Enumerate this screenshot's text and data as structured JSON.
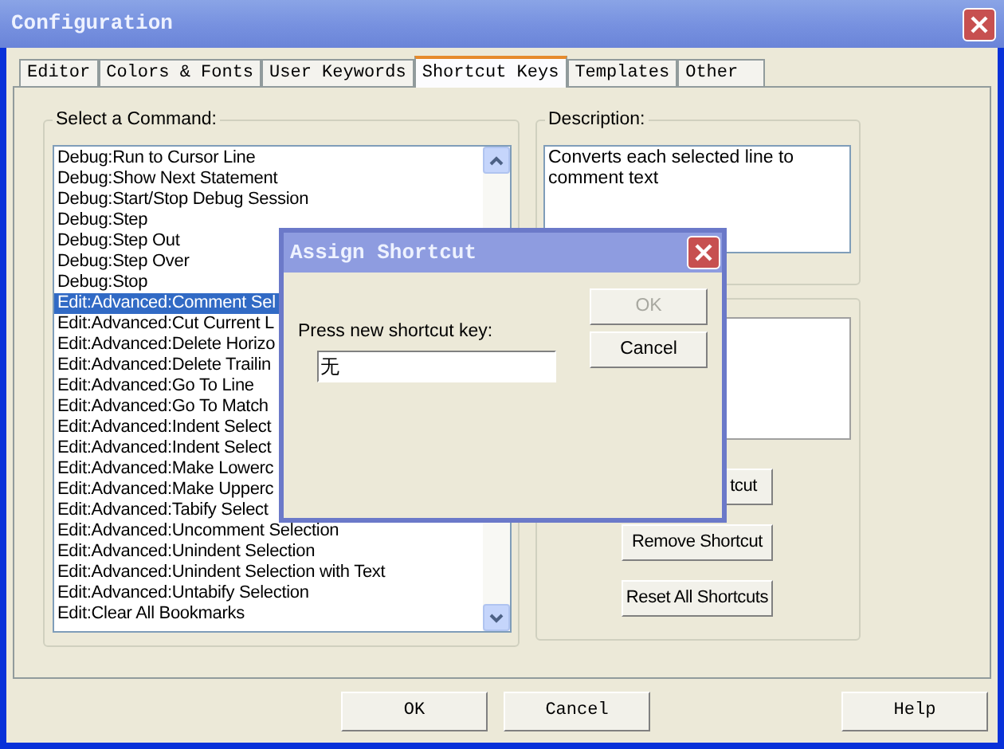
{
  "window": {
    "title": "Configuration"
  },
  "tabs": [
    {
      "label": "Editor",
      "selected": false
    },
    {
      "label": "Colors & Fonts",
      "selected": false
    },
    {
      "label": "User Keywords",
      "selected": false
    },
    {
      "label": "Shortcut Keys",
      "selected": true
    },
    {
      "label": "Templates",
      "selected": false
    },
    {
      "label": "Other",
      "selected": false
    }
  ],
  "command_group": {
    "label": "Select a Command:",
    "commands": [
      {
        "text": "Debug:Run to Cursor Line",
        "selected": false
      },
      {
        "text": "Debug:Show Next Statement",
        "selected": false
      },
      {
        "text": "Debug:Start/Stop Debug Session",
        "selected": false
      },
      {
        "text": "Debug:Step",
        "selected": false
      },
      {
        "text": "Debug:Step Out",
        "selected": false
      },
      {
        "text": "Debug:Step Over",
        "selected": false
      },
      {
        "text": "Debug:Stop",
        "selected": false
      },
      {
        "text": "Edit:Advanced:Comment Sel",
        "selected": true
      },
      {
        "text": "Edit:Advanced:Cut Current L",
        "selected": false
      },
      {
        "text": "Edit:Advanced:Delete Horizo",
        "selected": false
      },
      {
        "text": "Edit:Advanced:Delete Trailin",
        "selected": false
      },
      {
        "text": "Edit:Advanced:Go To Line",
        "selected": false
      },
      {
        "text": "Edit:Advanced:Go To Match",
        "selected": false
      },
      {
        "text": "Edit:Advanced:Indent Select",
        "selected": false
      },
      {
        "text": "Edit:Advanced:Indent Select",
        "selected": false
      },
      {
        "text": "Edit:Advanced:Make Lowerc",
        "selected": false
      },
      {
        "text": "Edit:Advanced:Make Upperc",
        "selected": false
      },
      {
        "text": "Edit:Advanced:Tabify Select",
        "selected": false
      },
      {
        "text": "Edit:Advanced:Uncomment Selection",
        "selected": false
      },
      {
        "text": "Edit:Advanced:Unindent Selection",
        "selected": false
      },
      {
        "text": "Edit:Advanced:Unindent Selection with Text",
        "selected": false
      },
      {
        "text": "Edit:Advanced:Untabify Selection",
        "selected": false
      },
      {
        "text": "Edit:Clear All Bookmarks",
        "selected": false
      }
    ]
  },
  "description_group": {
    "label": "Description:",
    "text": "Converts each selected line to comment text"
  },
  "shortcut_buttons": [
    {
      "label": "tcut",
      "disabled": false
    },
    {
      "label": "Remove Shortcut",
      "disabled": false
    },
    {
      "label": "Reset All Shortcuts",
      "disabled": false
    }
  ],
  "footer_buttons": [
    {
      "label": "OK"
    },
    {
      "label": "Cancel"
    },
    {
      "label": "Help"
    }
  ],
  "dialog": {
    "title": "Assign Shortcut",
    "prompt": "Press new shortcut key:",
    "value": "无",
    "buttons": [
      {
        "label": "OK",
        "disabled": true
      },
      {
        "label": "Cancel",
        "disabled": false
      }
    ]
  }
}
